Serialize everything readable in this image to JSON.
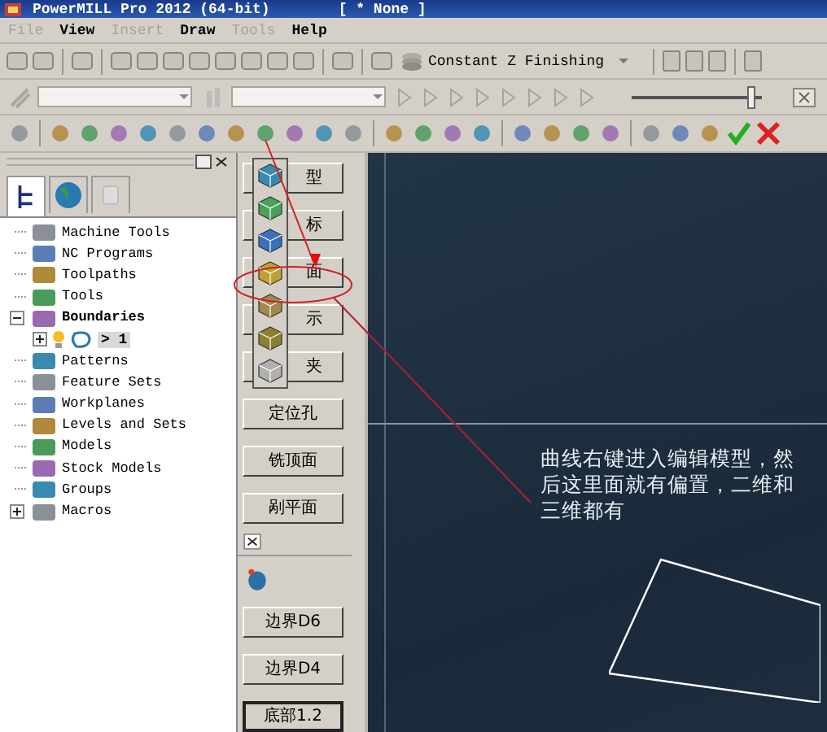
{
  "window": {
    "title": "PowerMILL Pro 2012 (64-bit)",
    "document": "[ * None ]"
  },
  "menu": [
    {
      "label": "File",
      "disabled": true
    },
    {
      "label": "View",
      "disabled": false
    },
    {
      "label": "Insert",
      "disabled": true
    },
    {
      "label": "Draw",
      "disabled": false
    },
    {
      "label": "Tools",
      "disabled": true
    },
    {
      "label": "Help",
      "disabled": false
    }
  ],
  "toolbar": {
    "strategy": "Constant Z Finishing"
  },
  "playback": {
    "level": 0.93
  },
  "explorer": {
    "tabs": [
      {
        "selected": true
      },
      {
        "selected": false
      },
      {
        "selected": false
      }
    ],
    "tree": [
      {
        "label": "Machine Tools",
        "expandable": false,
        "expanded": false,
        "active": false
      },
      {
        "label": "NC Programs",
        "expandable": false,
        "expanded": false,
        "active": false
      },
      {
        "label": "Toolpaths",
        "expandable": false,
        "expanded": false,
        "active": false
      },
      {
        "label": "Tools",
        "expandable": false,
        "expanded": false,
        "active": false
      },
      {
        "label": "Boundaries",
        "expandable": true,
        "expanded": true,
        "active": true,
        "children": [
          {
            "label": "> 1",
            "expandable": true,
            "expanded": false,
            "selected": true
          }
        ]
      },
      {
        "label": "Patterns",
        "expandable": false,
        "expanded": false,
        "active": false
      },
      {
        "label": "Feature Sets",
        "expandable": false,
        "expanded": false,
        "active": false
      },
      {
        "label": "Workplanes",
        "expandable": false,
        "expanded": false,
        "active": false
      },
      {
        "label": "Levels and Sets",
        "expandable": false,
        "expanded": false,
        "active": false
      },
      {
        "label": "Models",
        "expandable": false,
        "expanded": false,
        "active": false
      },
      {
        "label": "Stock Models",
        "expandable": false,
        "expanded": false,
        "active": false
      },
      {
        "label": "Groups",
        "expandable": false,
        "expanded": false,
        "active": false
      },
      {
        "label": "Macros",
        "expandable": true,
        "expanded": false,
        "active": false
      }
    ]
  },
  "buttons": [
    {
      "label": "型"
    },
    {
      "label": "标"
    },
    {
      "label": "面"
    },
    {
      "label": "示"
    },
    {
      "label": "夹"
    },
    {
      "label": "定位孔"
    },
    {
      "label": "铣顶面"
    },
    {
      "label": "剐平面"
    }
  ],
  "bottom_buttons": [
    {
      "label": "边界D6",
      "focused": false
    },
    {
      "label": "边界D4",
      "focused": false
    },
    {
      "label": "底部1.2",
      "focused": true
    }
  ],
  "note": "曲线右键进入编辑模型，然后这里面就有偏置，二维和三维都有"
}
